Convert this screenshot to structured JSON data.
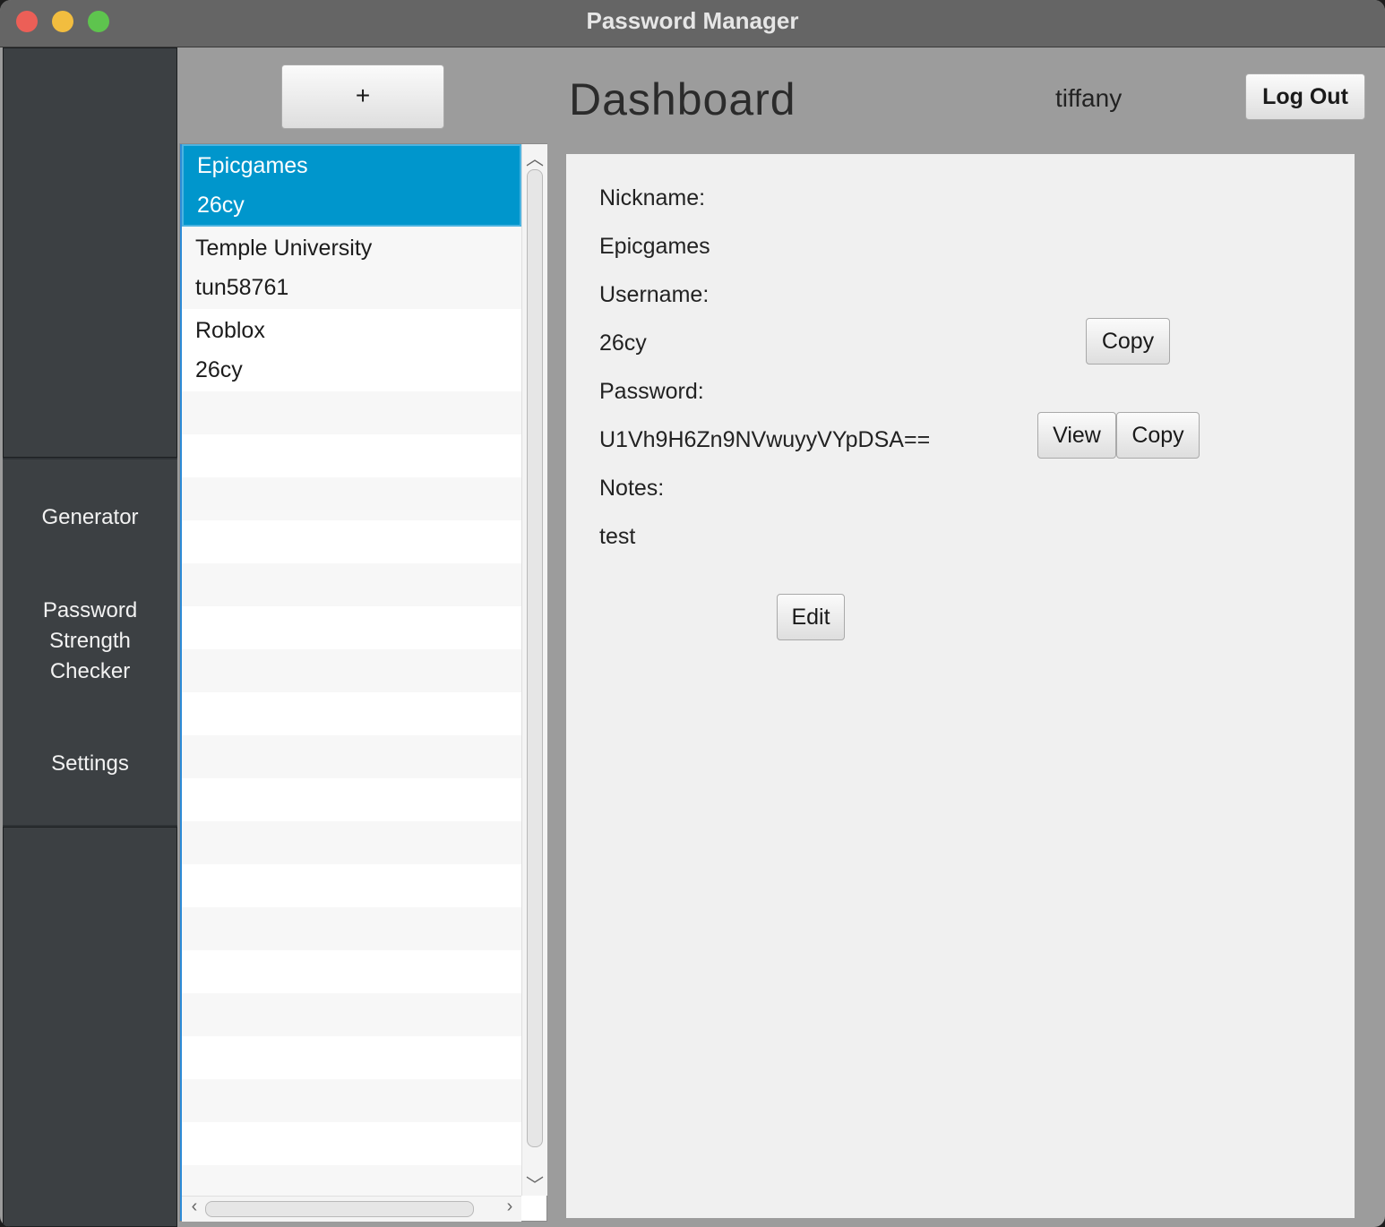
{
  "window": {
    "title": "Password Manager"
  },
  "sidebar": {
    "items": [
      {
        "label": "Generator"
      },
      {
        "label": "Password\nStrength\nChecker"
      },
      {
        "label": "Settings"
      }
    ]
  },
  "header": {
    "add_label": "+",
    "title": "Dashboard",
    "username": "tiffany",
    "logout_label": "Log Out"
  },
  "entries": [
    {
      "nickname": "Epicgames",
      "username": "26cy",
      "selected": true
    },
    {
      "nickname": "Temple University",
      "username": "tun58761",
      "selected": false
    },
    {
      "nickname": "Roblox",
      "username": "26cy",
      "selected": false
    }
  ],
  "detail": {
    "nickname_label": "Nickname:",
    "nickname_value": "Epicgames",
    "username_label": "Username:",
    "username_value": "26cy",
    "password_label": "Password:",
    "password_value": "U1Vh9H6Zn9NVwuyyVYpDSA==",
    "notes_label": "Notes:",
    "notes_value": "test",
    "copy_label": "Copy",
    "view_label": "View",
    "edit_label": "Edit"
  },
  "icons": {
    "scroll_up": "chevron-up-icon",
    "scroll_down": "chevron-down-icon",
    "scroll_left": "chevron-left-icon",
    "scroll_right": "chevron-right-icon"
  },
  "colors": {
    "selection": "#0096cc",
    "sidebar": "#3c4043",
    "titlebar": "#656565"
  }
}
